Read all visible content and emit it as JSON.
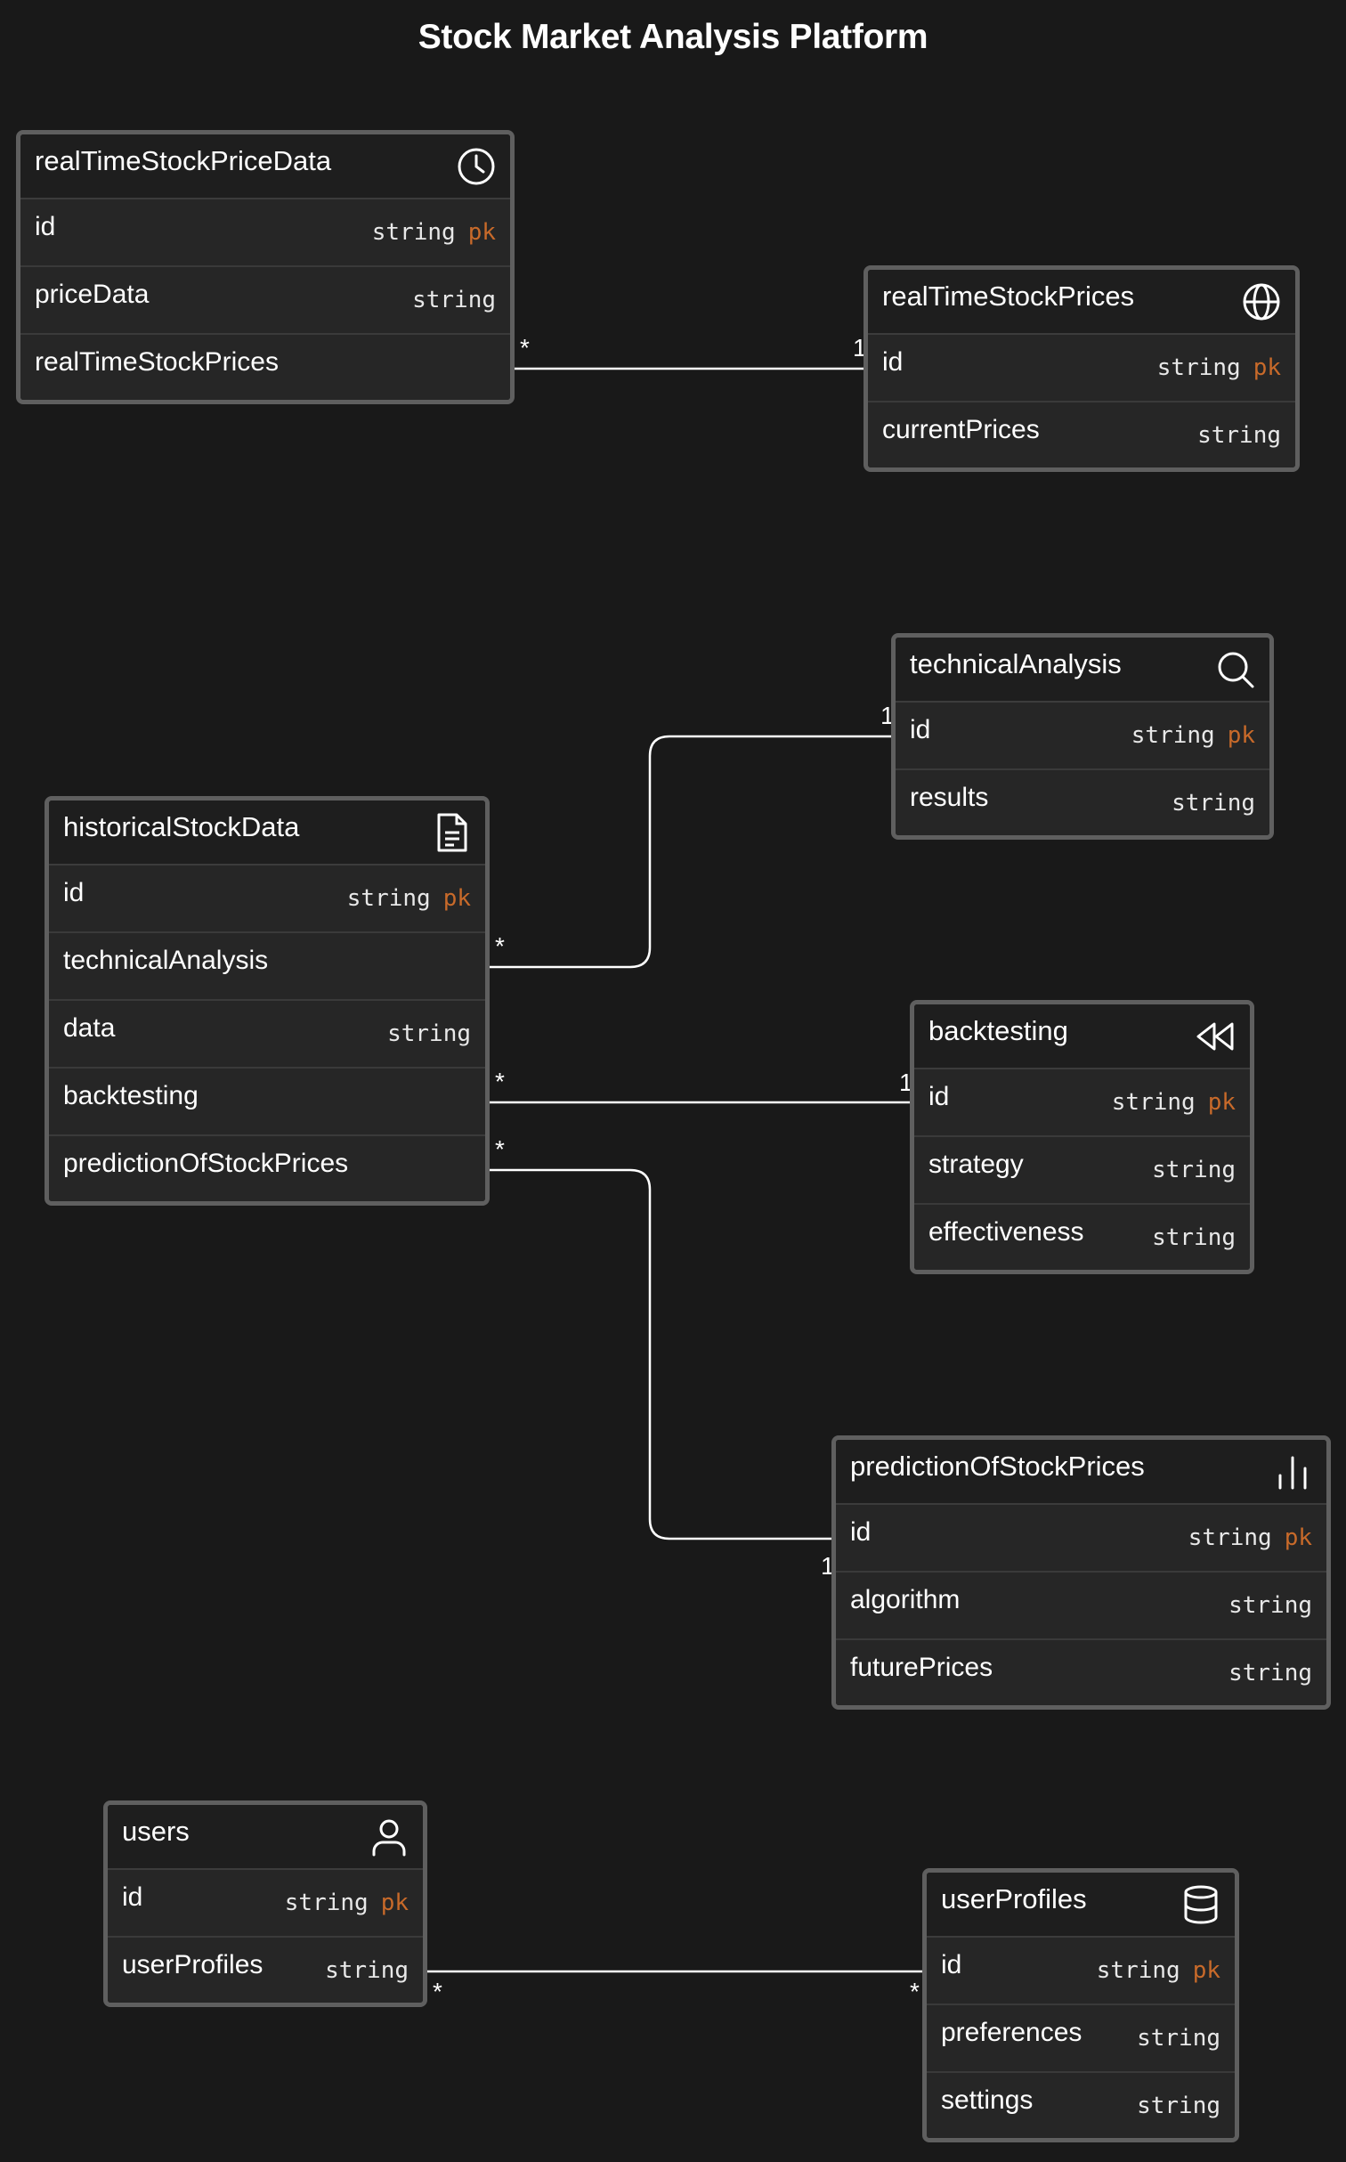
{
  "title": "Stock Market Analysis Platform",
  "colors": {
    "background": "#191919",
    "entity_border": "#5f5f5f",
    "pk_text": "#c86a2a",
    "line": "#ffffff"
  },
  "entities": [
    {
      "name": "realTimeStockPriceData",
      "icon": "clock-icon",
      "fields": [
        {
          "name": "id",
          "type": "string",
          "key": "pk"
        },
        {
          "name": "priceData",
          "type": "string",
          "key": ""
        },
        {
          "name": "realTimeStockPrices",
          "type": "",
          "key": ""
        }
      ]
    },
    {
      "name": "realTimeStockPrices",
      "icon": "globe-icon",
      "fields": [
        {
          "name": "id",
          "type": "string",
          "key": "pk"
        },
        {
          "name": "currentPrices",
          "type": "string",
          "key": ""
        }
      ]
    },
    {
      "name": "technicalAnalysis",
      "icon": "search-icon",
      "fields": [
        {
          "name": "id",
          "type": "string",
          "key": "pk"
        },
        {
          "name": "results",
          "type": "string",
          "key": ""
        }
      ]
    },
    {
      "name": "historicalStockData",
      "icon": "document-icon",
      "fields": [
        {
          "name": "id",
          "type": "string",
          "key": "pk"
        },
        {
          "name": "technicalAnalysis",
          "type": "",
          "key": ""
        },
        {
          "name": "data",
          "type": "string",
          "key": ""
        },
        {
          "name": "backtesting",
          "type": "",
          "key": ""
        },
        {
          "name": "predictionOfStockPrices",
          "type": "",
          "key": ""
        }
      ]
    },
    {
      "name": "backtesting",
      "icon": "rewind-icon",
      "fields": [
        {
          "name": "id",
          "type": "string",
          "key": "pk"
        },
        {
          "name": "strategy",
          "type": "string",
          "key": ""
        },
        {
          "name": "effectiveness",
          "type": "string",
          "key": ""
        }
      ]
    },
    {
      "name": "predictionOfStockPrices",
      "icon": "bar-chart-icon",
      "fields": [
        {
          "name": "id",
          "type": "string",
          "key": "pk"
        },
        {
          "name": "algorithm",
          "type": "string",
          "key": ""
        },
        {
          "name": "futurePrices",
          "type": "string",
          "key": ""
        }
      ]
    },
    {
      "name": "users",
      "icon": "user-icon",
      "fields": [
        {
          "name": "id",
          "type": "string",
          "key": "pk"
        },
        {
          "name": "userProfiles",
          "type": "string",
          "key": ""
        }
      ]
    },
    {
      "name": "userProfiles",
      "icon": "database-icon",
      "fields": [
        {
          "name": "id",
          "type": "string",
          "key": "pk"
        },
        {
          "name": "preferences",
          "type": "string",
          "key": ""
        },
        {
          "name": "settings",
          "type": "string",
          "key": ""
        }
      ]
    }
  ],
  "relationships": [
    {
      "from": "realTimeStockPriceData.realTimeStockPrices",
      "to": "realTimeStockPrices.id",
      "from_card": "*",
      "to_card": "1"
    },
    {
      "from": "historicalStockData.technicalAnalysis",
      "to": "technicalAnalysis.id",
      "from_card": "*",
      "to_card": "1"
    },
    {
      "from": "historicalStockData.backtesting",
      "to": "backtesting.id",
      "from_card": "*",
      "to_card": "1"
    },
    {
      "from": "historicalStockData.predictionOfStockPrices",
      "to": "predictionOfStockPrices.id",
      "from_card": "*",
      "to_card": "1"
    },
    {
      "from": "users.userProfiles",
      "to": "userProfiles.id",
      "from_card": "*",
      "to_card": "*"
    }
  ]
}
